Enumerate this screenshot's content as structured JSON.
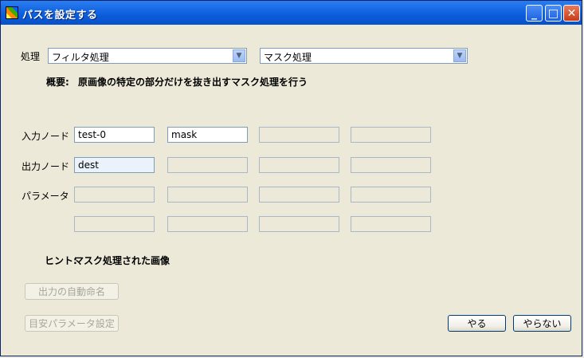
{
  "window": {
    "title": "パスを設定する"
  },
  "form": {
    "process_label": "処理",
    "process_select_value": "フィルタ処理",
    "subprocess_select_value": "マスク処理",
    "summary_label": "概要:",
    "summary_text": "原画像の特定の部分だけを抜き出すマスク処理を行う",
    "input_node_label": "入力ノード",
    "input_values": [
      "test-0",
      "mask",
      "",
      ""
    ],
    "output_node_label": "出力ノード",
    "output_values": [
      "dest",
      "",
      "",
      ""
    ],
    "parameter_label": "パラメータ",
    "parameter_row1": [
      "",
      "",
      "",
      ""
    ],
    "parameter_row2": [
      "",
      "",
      "",
      ""
    ],
    "hint_label": "ヒント:",
    "hint_text": "マスク処理された画像"
  },
  "buttons": {
    "auto_name": "出力の自動命名",
    "param_preset": "目安パラメータ設定",
    "do": "やる",
    "dont": "やらない"
  }
}
